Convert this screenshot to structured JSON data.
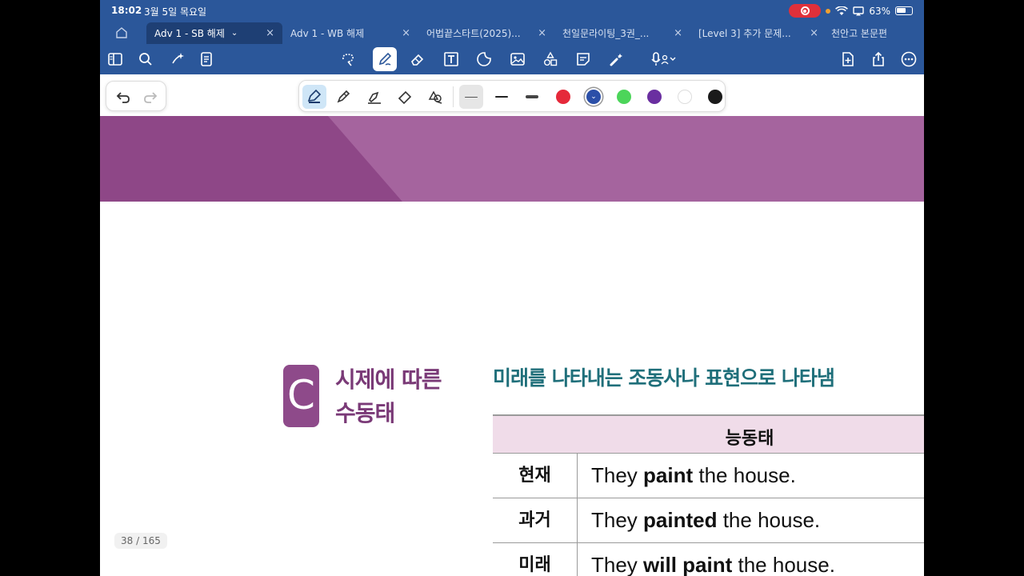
{
  "status": {
    "time": "18:02",
    "date": "3월 5일 목요일",
    "battery": "63%"
  },
  "tabs": [
    {
      "label": "Adv 1 - SB 해제",
      "active": true
    },
    {
      "label": "Adv 1 - WB 해제",
      "active": false
    },
    {
      "label": "어법끝스타트(2025)...",
      "active": false
    },
    {
      "label": "천일문라이팅_3권_...",
      "active": false
    },
    {
      "label": "[Level 3] 추가 문제...",
      "active": false
    },
    {
      "label": "천안고 본문편",
      "active": false
    }
  ],
  "toolbar_icons": [
    "sidebar-icon",
    "search-icon",
    "sparkle-icon",
    "document-icon",
    "lasso-icon",
    "pen-icon",
    "eraser-icon",
    "text-box-icon",
    "sticker-icon",
    "image-icon",
    "shapes-icon",
    "note-icon",
    "laser-icon",
    "microphone-icon",
    "add-page-icon",
    "share-icon",
    "more-icon"
  ],
  "draw_tools": [
    "fountain-pen-icon",
    "ballpoint-icon",
    "highlighter-icon",
    "eraser-icon",
    "shape-tool-icon"
  ],
  "pen_colors": [
    "#e5293a",
    "#2b4fa8",
    "#4cd55a",
    "#6a2fa0",
    "#ffffff",
    "#1a1a1a"
  ],
  "selected_color": "#2b4fa8",
  "document": {
    "badge": "C",
    "section_title_line1": "시제에 따른",
    "section_title_line2": "수동태",
    "subtitle": "미래를 나타내는 조동사나 표현으로 나타냄",
    "table_header": "능동태",
    "rows": [
      {
        "label": "현재",
        "pre": "They ",
        "bold": "paint",
        "post": " the house."
      },
      {
        "label": "과거",
        "pre": "They ",
        "bold": "painted",
        "post": " the house."
      },
      {
        "label": "미래",
        "pre": "They ",
        "bold": "will paint",
        "post": " the house."
      }
    ],
    "page_indicator": "38 / 165"
  }
}
